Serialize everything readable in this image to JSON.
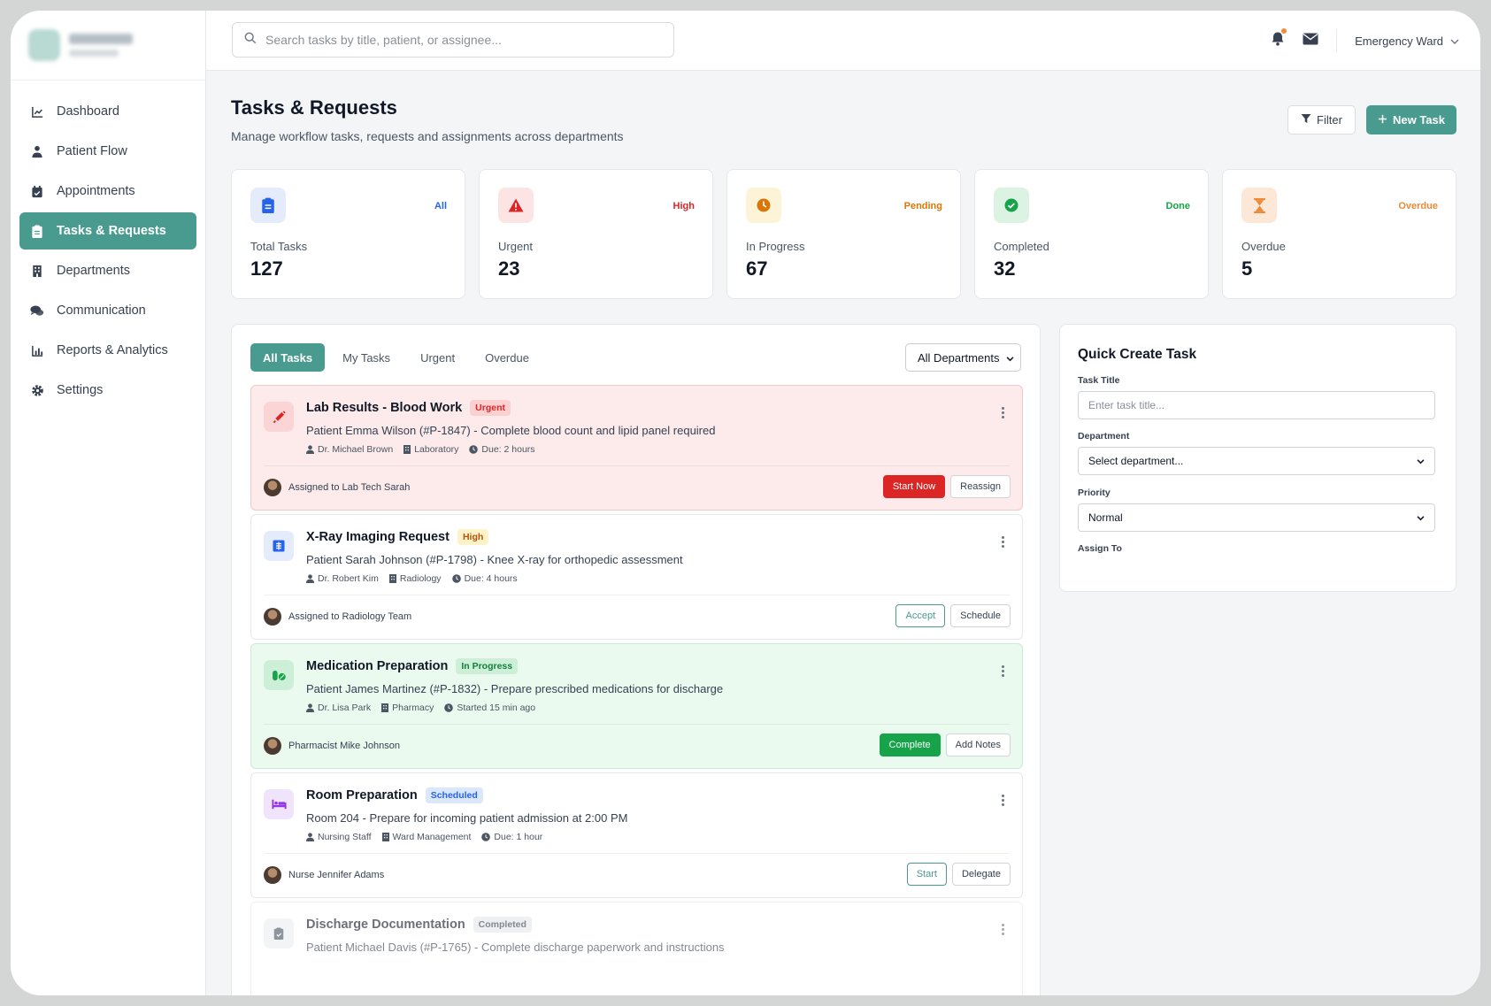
{
  "sidebar": {
    "items": [
      {
        "label": "Dashboard",
        "icon": "chart-line-icon"
      },
      {
        "label": "Patient Flow",
        "icon": "user-injured-icon"
      },
      {
        "label": "Appointments",
        "icon": "calendar-check-icon"
      },
      {
        "label": "Tasks & Requests",
        "icon": "clipboard-list-icon",
        "active": true
      },
      {
        "label": "Departments",
        "icon": "building-icon"
      },
      {
        "label": "Communication",
        "icon": "comments-icon"
      },
      {
        "label": "Reports & Analytics",
        "icon": "chart-bar-icon"
      },
      {
        "label": "Settings",
        "icon": "gear-icon"
      }
    ]
  },
  "topbar": {
    "search_placeholder": "Search tasks by title, patient, or assignee...",
    "ward": "Emergency Ward"
  },
  "page": {
    "title": "Tasks & Requests",
    "subtitle": "Manage workflow tasks, requests and assignments across departments",
    "filter_label": "Filter",
    "new_task_label": "New Task"
  },
  "stats": [
    {
      "label": "Total Tasks",
      "value": "127",
      "tag": "All",
      "tag_color": "#2563eb",
      "icon_bg": "#e4ecfb",
      "icon_color": "#2563eb",
      "icon": "clipboard-icon"
    },
    {
      "label": "Urgent",
      "value": "23",
      "tag": "High",
      "tag_color": "#dc2626",
      "icon_bg": "#fde4e4",
      "icon_color": "#dc2626",
      "icon": "warning-icon"
    },
    {
      "label": "In Progress",
      "value": "67",
      "tag": "Pending",
      "tag_color": "#d97706",
      "icon_bg": "#fdf3d9",
      "icon_color": "#d97706",
      "icon": "clock-icon"
    },
    {
      "label": "Completed",
      "value": "32",
      "tag": "Done",
      "tag_color": "#16a34a",
      "icon_bg": "#dcf3e3",
      "icon_color": "#16a34a",
      "icon": "check-circle-icon"
    },
    {
      "label": "Overdue",
      "value": "5",
      "tag": "Overdue",
      "tag_color": "#ea8a3a",
      "icon_bg": "#fde8d8",
      "icon_color": "#ea8a3a",
      "icon": "hourglass-icon"
    }
  ],
  "tabs": [
    "All Tasks",
    "My Tasks",
    "Urgent",
    "Overdue"
  ],
  "department_filter": "All Departments",
  "tasks": [
    {
      "title": "Lab Results - Blood Work",
      "badge": "Urgent",
      "desc": "Patient Emma Wilson (#P-1847) - Complete blood count and lipid panel required",
      "person": "Dr. Michael Brown",
      "dept": "Laboratory",
      "time": "Due: 2 hours",
      "assignee": "Assigned to Lab Tech Sarah",
      "actions": [
        "Start Now",
        "Reassign"
      ]
    },
    {
      "title": "X-Ray Imaging Request",
      "badge": "High",
      "desc": "Patient Sarah Johnson (#P-1798) - Knee X-ray for orthopedic assessment",
      "person": "Dr. Robert Kim",
      "dept": "Radiology",
      "time": "Due: 4 hours",
      "assignee": "Assigned to Radiology Team",
      "actions": [
        "Accept",
        "Schedule"
      ]
    },
    {
      "title": "Medication Preparation",
      "badge": "In Progress",
      "desc": "Patient James Martinez (#P-1832) - Prepare prescribed medications for discharge",
      "person": "Dr. Lisa Park",
      "dept": "Pharmacy",
      "time": "Started 15 min ago",
      "assignee": "Pharmacist Mike Johnson",
      "actions": [
        "Complete",
        "Add Notes"
      ]
    },
    {
      "title": "Room Preparation",
      "badge": "Scheduled",
      "desc": "Room 204 - Prepare for incoming patient admission at 2:00 PM",
      "person": "Nursing Staff",
      "dept": "Ward Management",
      "time": "Due: 1 hour",
      "assignee": "Nurse Jennifer Adams",
      "actions": [
        "Start",
        "Delegate"
      ]
    },
    {
      "title": "Discharge Documentation",
      "badge": "Completed",
      "desc": "Patient Michael Davis (#P-1765) - Complete discharge paperwork and instructions"
    }
  ],
  "quick_create": {
    "title": "Quick Create Task",
    "task_title_label": "Task Title",
    "task_title_placeholder": "Enter task title...",
    "department_label": "Department",
    "department_value": "Select department...",
    "priority_label": "Priority",
    "priority_value": "Normal",
    "assign_label": "Assign To"
  }
}
